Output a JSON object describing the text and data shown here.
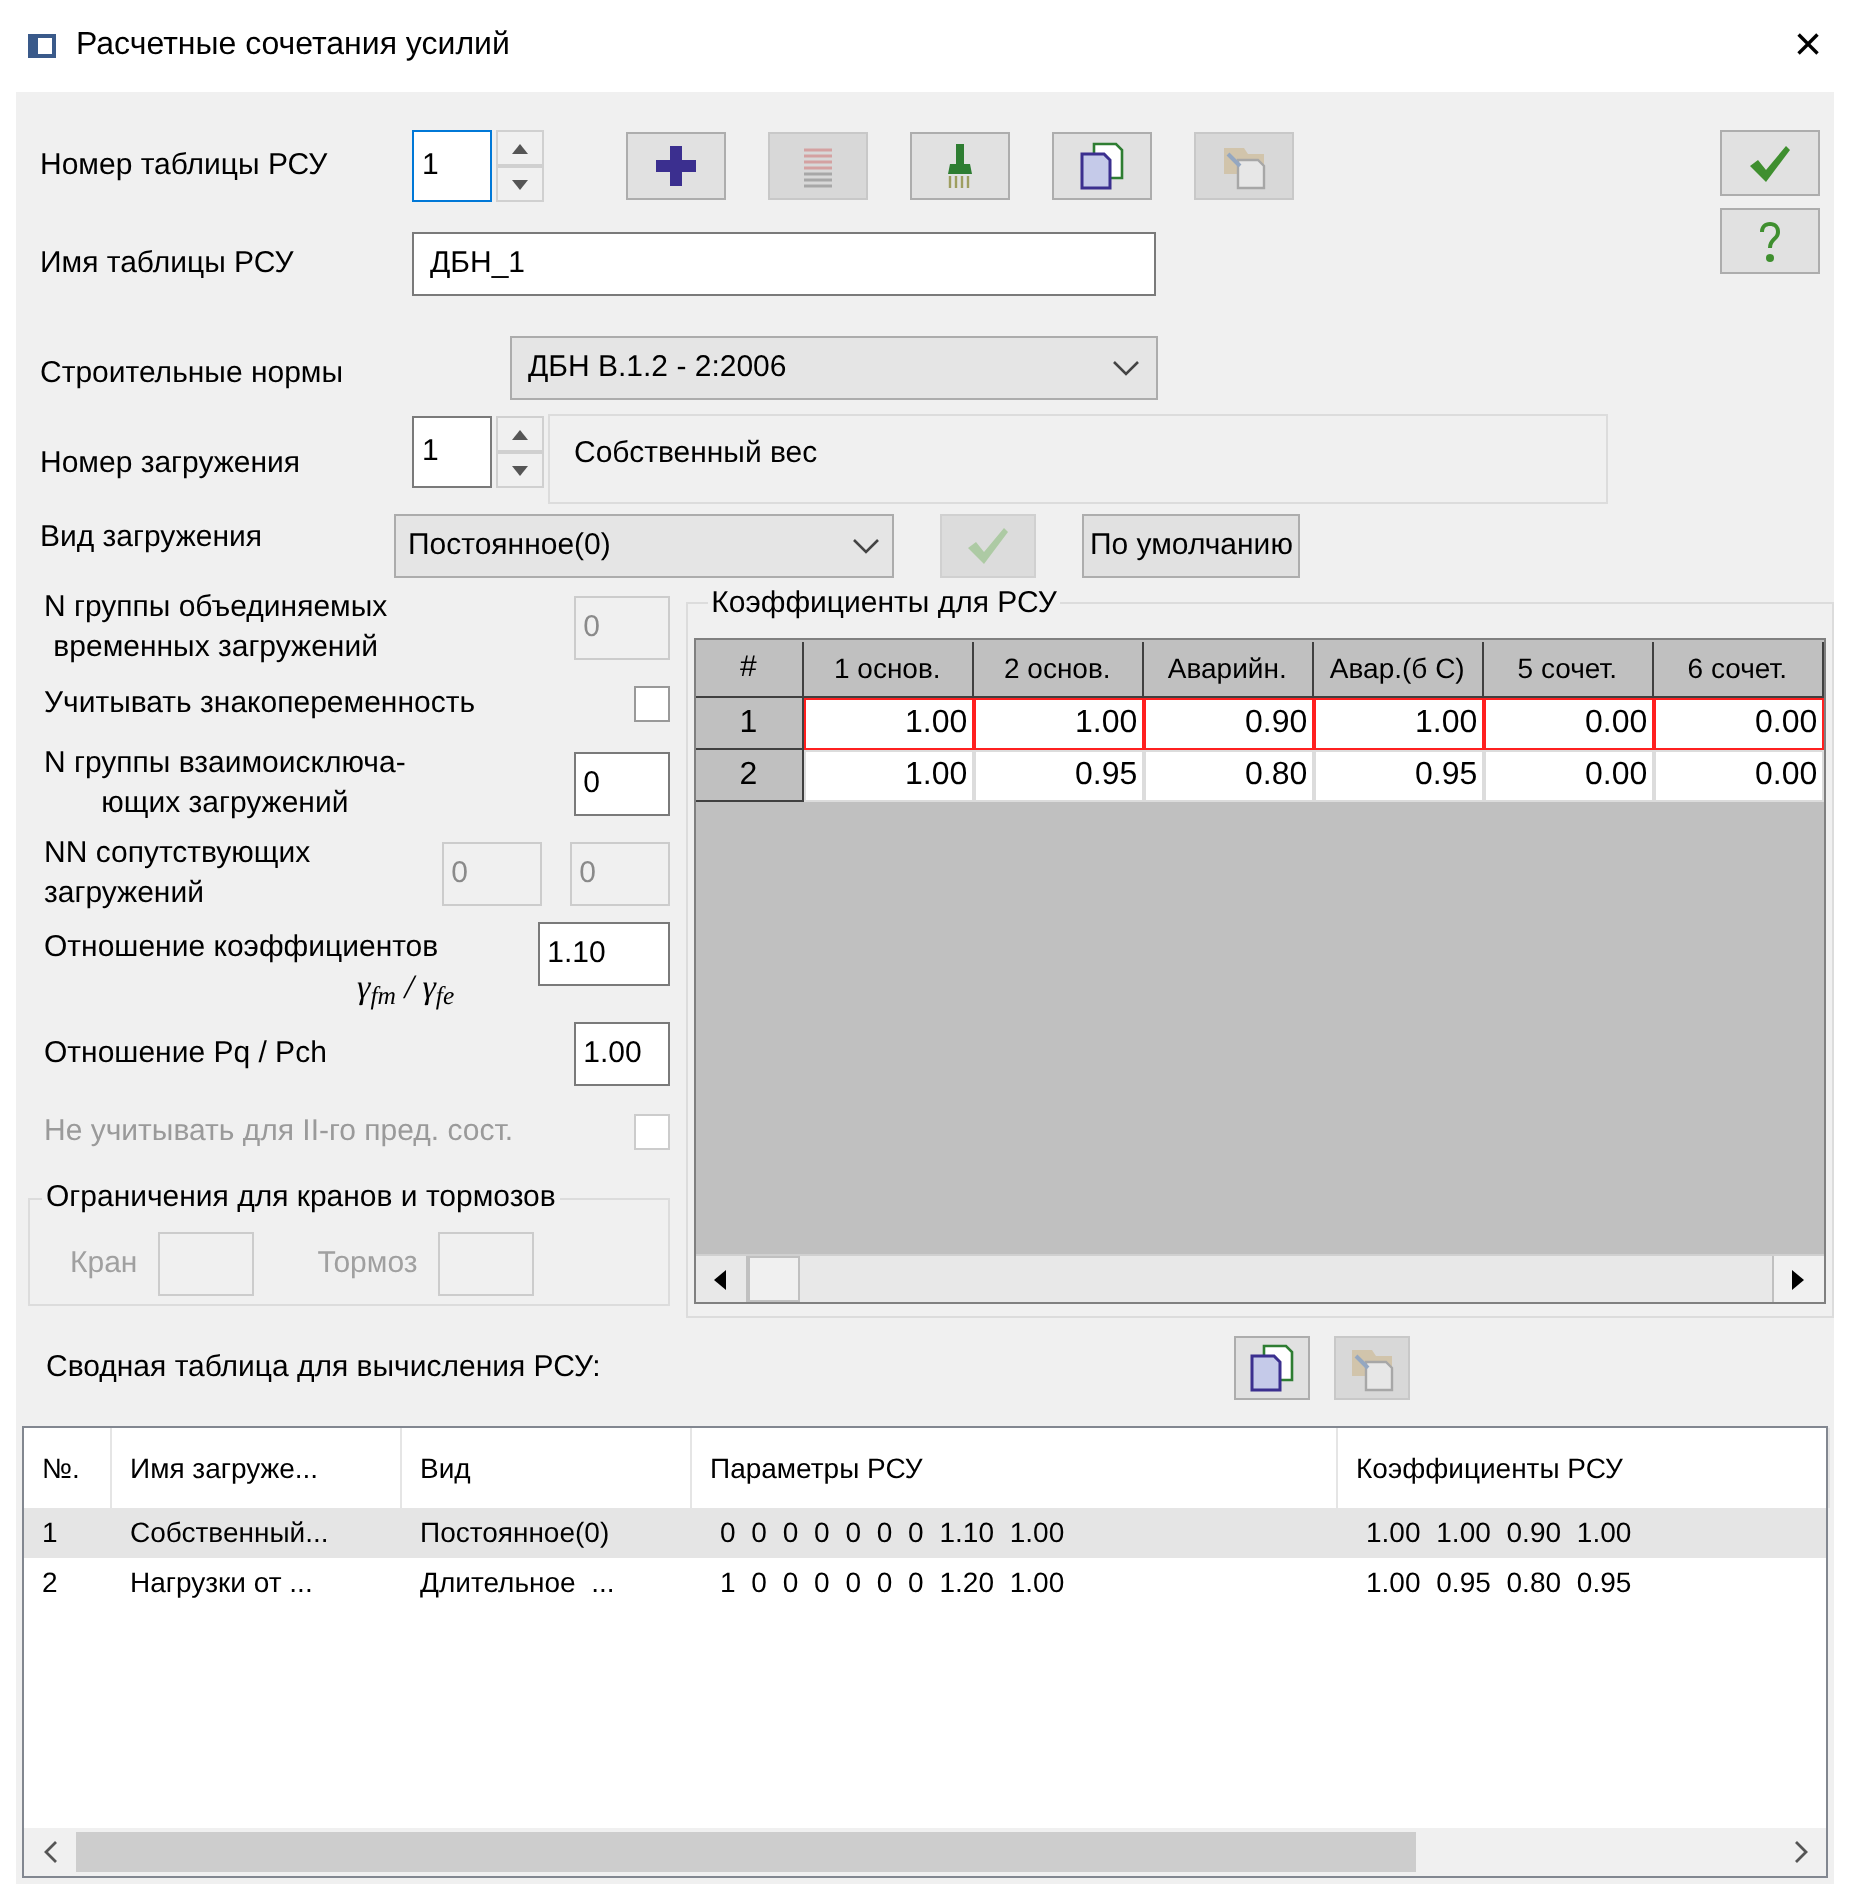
{
  "window": {
    "title": "Расчетные сочетания усилий",
    "close": "×"
  },
  "table_number": {
    "label": "Номер таблицы РСУ",
    "value": "1"
  },
  "toolbar": [
    {
      "kind": "add",
      "disabled": false
    },
    {
      "kind": "list",
      "disabled": true
    },
    {
      "kind": "brush",
      "disabled": false
    },
    {
      "kind": "copy",
      "disabled": false
    },
    {
      "kind": "paste",
      "disabled": true
    }
  ],
  "side_buttons": [
    {
      "kind": "ok"
    },
    {
      "kind": "help"
    }
  ],
  "table_name": {
    "label": "Имя таблицы РСУ",
    "value": "ДБН_1"
  },
  "building_code": {
    "label": "Строительные нормы",
    "value": "ДБН В.1.2 - 2:2006"
  },
  "load_number": {
    "label": "Номер загружения",
    "value": "1",
    "load_name": "Собственный вес"
  },
  "load_type": {
    "label": "Вид загружения",
    "value": "Постоянное(0)",
    "apply_disabled": true,
    "default_button": "По умолчанию"
  },
  "params": [
    {
      "kind": "field",
      "label": "N группы объединяемых\nвременных загружений",
      "value": "0",
      "disabled": true
    },
    {
      "kind": "checkbox",
      "label": "Учитывать знакопеременность",
      "checked": false,
      "disabled": false
    },
    {
      "kind": "field",
      "label": "N группы взаимоисключа-\nющих загружений",
      "value": "0",
      "disabled": false
    },
    {
      "kind": "pair",
      "label": "NN сопутствующих\nзагружений",
      "values": [
        "0",
        "0"
      ],
      "disabled": true
    },
    {
      "kind": "ratio",
      "label": "Отношение коэффициентов",
      "sublabel": "γ$_{fm}$ / γ$_{fe}$",
      "value": "1.10",
      "disabled": false
    },
    {
      "kind": "field",
      "label": "Отношение  Pq / Pch",
      "value": "1.00",
      "disabled": false
    },
    {
      "kind": "checkbox",
      "label": "Не учитывать для II-го пред. сост.",
      "checked": false,
      "disabled": true
    }
  ],
  "crane_limits": {
    "title": "Ограничения для кранов и тормозов",
    "fields": [
      {
        "label": "Кран",
        "disabled": true
      },
      {
        "label": "Тормоз",
        "disabled": true
      }
    ]
  },
  "coefficients": {
    "title": "Коэффициенты для РСУ",
    "columns": [
      "#",
      "1 основ.",
      "2 основ.",
      "Аварийн.",
      "Авар.(б С)",
      "5 сочет.",
      "6 сочет."
    ],
    "rows": [
      {
        "cells": [
          "1",
          "1.00",
          "1.00",
          "0.90",
          "1.00",
          "0.00",
          "0.00"
        ],
        "selected": true
      },
      {
        "cells": [
          "2",
          "1.00",
          "0.95",
          "0.80",
          "0.95",
          "0.00",
          "0.00"
        ],
        "selected": false
      }
    ]
  },
  "summary": {
    "label": "Сводная таблица для вычисления РСУ:",
    "buttons": [
      {
        "kind": "copy",
        "disabled": false
      },
      {
        "kind": "paste",
        "disabled": true
      }
    ],
    "columns": [
      "№.",
      "Имя загруже...",
      "Вид",
      "Параметры РСУ",
      "Коэффициенты РСУ"
    ],
    "rows": [
      {
        "cells": [
          "1",
          "Собственный...",
          "Постоянное(0)",
          "0 0 0 0 0 0 0 1.10 1.00",
          "1.00 1.00 0.90 1.00"
        ],
        "selected": true
      },
      {
        "cells": [
          "2",
          "Нагрузки от ...",
          "Длительное  ...",
          "1 0 0 0 0 0 0 1.20 1.00",
          "1.00 0.95 0.80 0.95"
        ],
        "selected": false
      }
    ]
  }
}
